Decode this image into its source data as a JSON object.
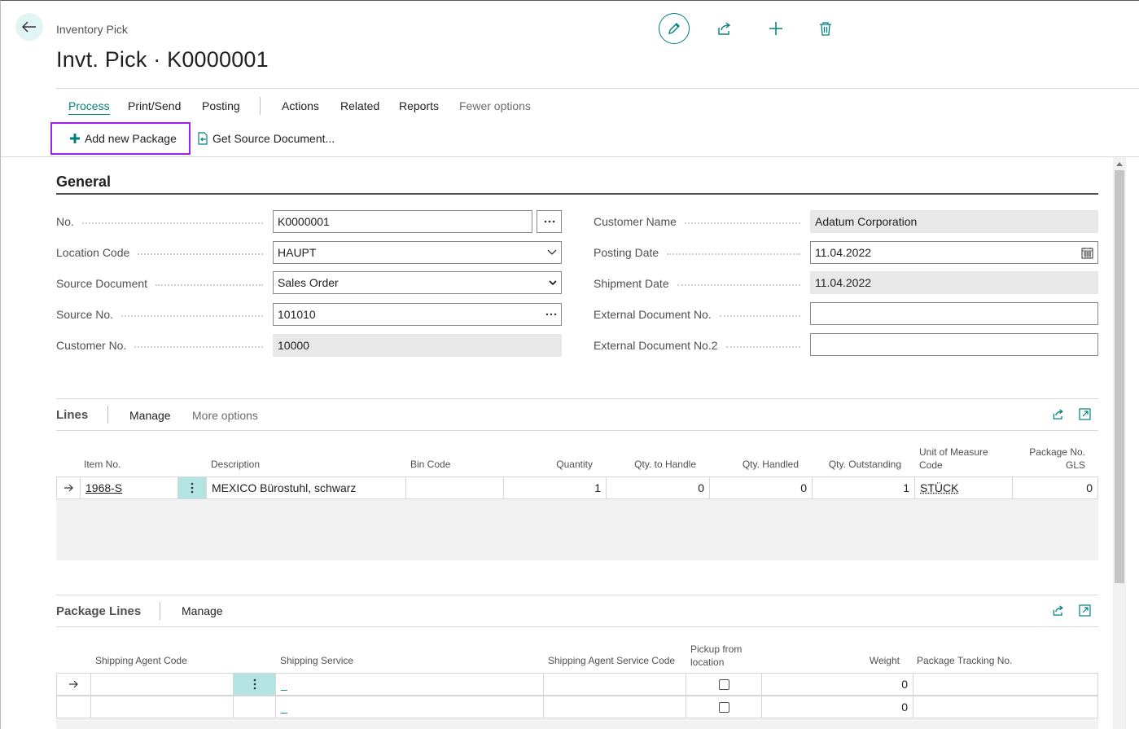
{
  "header": {
    "breadcrumb": "Inventory Pick",
    "title": "Invt. Pick · K0000001",
    "icons": [
      "back-arrow-icon",
      "pencil-icon",
      "share-icon",
      "plus-icon",
      "trash-icon"
    ]
  },
  "menu": {
    "items": [
      "Process",
      "Print/Send",
      "Posting",
      "Actions",
      "Related",
      "Reports",
      "Fewer options"
    ],
    "active": "Process"
  },
  "actions": {
    "add_package": "Add new Package",
    "get_source": "Get Source Document..."
  },
  "general": {
    "title": "General",
    "left": [
      {
        "label": "No.",
        "value": "K0000001"
      },
      {
        "label": "Location Code",
        "value": "HAUPT"
      },
      {
        "label": "Source Document",
        "value": "Sales Order"
      },
      {
        "label": "Source No.",
        "value": "101010"
      },
      {
        "label": "Customer No.",
        "value": "10000"
      }
    ],
    "right": [
      {
        "label": "Customer Name",
        "value": "Adatum Corporation"
      },
      {
        "label": "Posting Date",
        "value": "11.04.2022"
      },
      {
        "label": "Shipment Date",
        "value": "11.04.2022"
      },
      {
        "label": "External Document No.",
        "value": ""
      },
      {
        "label": "External Document No.2",
        "value": ""
      }
    ]
  },
  "lines": {
    "title": "Lines",
    "actions": [
      "Manage",
      "More options"
    ],
    "columns": [
      "Item No.",
      "Description",
      "Bin Code",
      "Quantity",
      "Qty. to Handle",
      "Qty. Handled",
      "Qty. Outstanding",
      "Unit of Measure Code",
      "Package No. GLS"
    ],
    "rows": [
      {
        "item_no": "1968-S",
        "description": "MEXICO Bürostuhl, schwarz",
        "bin_code": "",
        "quantity": "1",
        "qty_to_handle": "0",
        "qty_handled": "0",
        "qty_outstanding": "1",
        "uom": "STÜCK",
        "package_no": "0"
      }
    ]
  },
  "package_lines": {
    "title": "Package Lines",
    "actions": [
      "Manage"
    ],
    "columns": [
      "Shipping Agent Code",
      "Shipping Service",
      "Shipping Agent Service Code",
      "Pickup from location",
      "Weight",
      "Package Tracking No."
    ],
    "rows": [
      {
        "shipping_agent": "",
        "service": "_",
        "agent_service_code": "",
        "pickup": false,
        "weight": "0",
        "tracking": ""
      },
      {
        "shipping_agent": "",
        "service": "_",
        "agent_service_code": "",
        "pickup": false,
        "weight": "0",
        "tracking": ""
      }
    ]
  },
  "colors": {
    "accent": "#00817e",
    "highlight_border": "#a020f0",
    "menu_cell": "#b3e3e3"
  }
}
